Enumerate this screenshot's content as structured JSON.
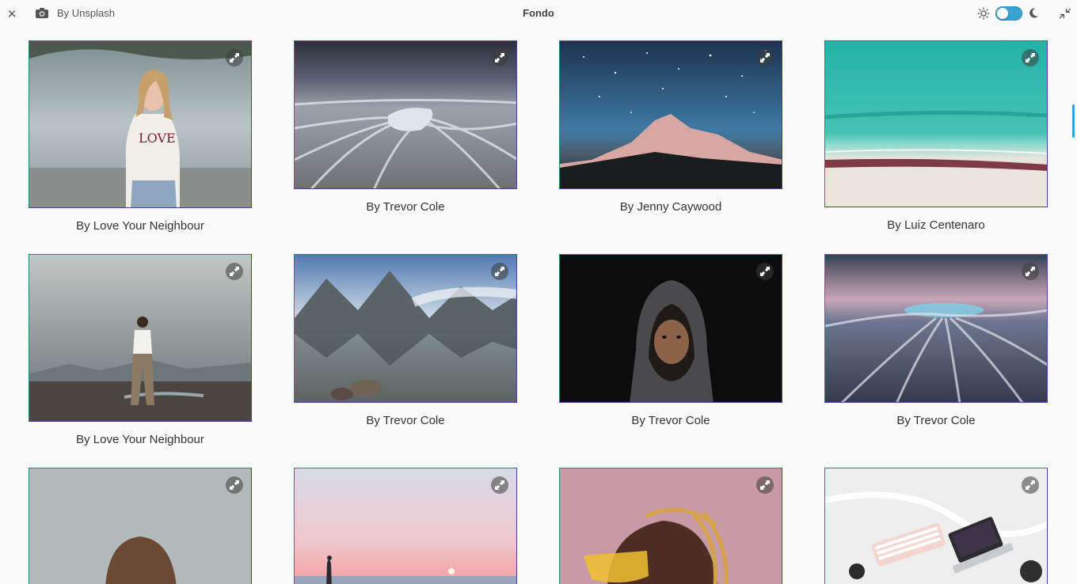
{
  "window": {
    "title": "Fondo",
    "source_label": "By Unsplash",
    "close_glyph": "×",
    "icons": {
      "close": "close-icon",
      "camera": "camera-icon",
      "sun": "sun-icon",
      "moon": "moon-icon",
      "restore": "restore-icon"
    },
    "dark_mode_enabled": true
  },
  "accent_color": "#3aa3d3",
  "photos": [
    {
      "caption": "By Love Your Neighbour",
      "scene": "woman-love-tshirt"
    },
    {
      "caption": "By Trevor Cole",
      "scene": "ice-beach-long-exposure"
    },
    {
      "caption": "By Jenny Caywood",
      "scene": "starry-mountain"
    },
    {
      "caption": "By Luiz Centenaro",
      "scene": "aerial-beach"
    },
    {
      "caption": "By Love Your Neighbour",
      "scene": "man-on-shore"
    },
    {
      "caption": "By Trevor Cole",
      "scene": "mountain-lake-reflection"
    },
    {
      "caption": "By Trevor Cole",
      "scene": "hooded-child-portrait"
    },
    {
      "caption": "By Trevor Cole",
      "scene": "wave-long-exposure"
    },
    {
      "caption": "",
      "scene": "woman-back-gray"
    },
    {
      "caption": "",
      "scene": "sunset-sea-person"
    },
    {
      "caption": "",
      "scene": "braids-yellow-sunglasses"
    },
    {
      "caption": "",
      "scene": "keyboard-laptop-flatlay"
    }
  ]
}
